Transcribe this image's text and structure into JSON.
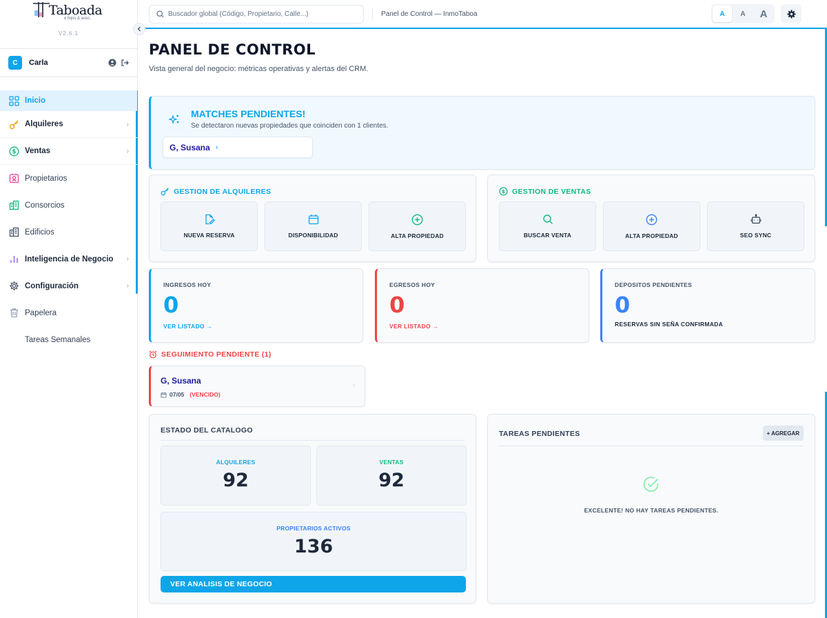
{
  "app": {
    "logo_text": "Taboada",
    "logo_sub": "e hijos & asoc.",
    "version": "V2.6.1"
  },
  "user": {
    "initial": "C",
    "name": "Carla"
  },
  "sidebar": {
    "items": [
      {
        "label": "Inicio",
        "icon": "grid-icon"
      },
      {
        "label": "Alquileres",
        "icon": "key-icon"
      },
      {
        "label": "Ventas",
        "icon": "dollar-circle-icon"
      },
      {
        "label": "Propietarios",
        "icon": "contact-icon"
      },
      {
        "label": "Consorcios",
        "icon": "building-icon"
      },
      {
        "label": "Edificios",
        "icon": "building-icon"
      },
      {
        "label": "Inteligencia de Negocio",
        "icon": "bar-chart-icon"
      },
      {
        "label": "Configuración",
        "icon": "gear-icon"
      },
      {
        "label": "Papelera",
        "icon": "trash-icon"
      },
      {
        "label": "Tareas Semanales"
      }
    ]
  },
  "topbar": {
    "search_placeholder": "Buscador global (Código, Propietario, Calle...)",
    "breadcrumb": "Panel de Control — InmoTaboa",
    "font_sizes": [
      "A",
      "A",
      "A"
    ]
  },
  "page": {
    "title": "PANEL DE CONTROL",
    "subtitle": "Vista general del negocio: métricas operativas y alertas del CRM."
  },
  "matches": {
    "title": "MATCHES PENDIENTES!",
    "description": "Se detectaron nuevas propiedades que coinciden con 1 clientes.",
    "client": "G, Susana",
    "arrow": "›"
  },
  "alquileres": {
    "title": "GESTION DE ALQUILERES",
    "buttons": [
      "NUEVA RESERVA",
      "DISPONIBILIDAD",
      "ALTA PROPIEDAD"
    ]
  },
  "ventas": {
    "title": "GESTION DE VENTAS",
    "buttons": [
      "BUSCAR VENTA",
      "ALTA PROPIEDAD",
      "SEO SYNC"
    ]
  },
  "stats": {
    "ingresos": {
      "label": "INGRESOS HOY",
      "value": "0",
      "link": "VER LISTADO →"
    },
    "egresos": {
      "label": "EGRESOS HOY",
      "value": "0",
      "link": "VER LISTADO →"
    },
    "depositos": {
      "label": "DEPOSITOS PENDIENTES",
      "value": "0",
      "note": "RESERVAS SIN SEÑA CONFIRMADA"
    }
  },
  "seguimiento": {
    "title": "SEGUIMIENTO PENDIENTE (1)",
    "client": "G, Susana",
    "date": "07/05",
    "status": "(VENCIDO)"
  },
  "catalog": {
    "title": "ESTADO DEL CATALOGO",
    "alquileres_label": "ALQUILERES",
    "alquileres_value": "92",
    "ventas_label": "VENTAS",
    "ventas_value": "92",
    "propietarios_label": "PROPIETARIOS ACTIVOS",
    "propietarios_value": "136",
    "button": "VER ANALISIS DE NEGOCIO"
  },
  "tasks": {
    "title": "TAREAS PENDIENTES",
    "add_label": "+ AGREGAR",
    "empty": "EXCELENTE! NO HAY TAREAS PENDIENTES."
  },
  "colors": {
    "accent": "#0ea5e9",
    "danger": "#ef4444",
    "success": "#10b981",
    "info": "#3b82f6",
    "rent": "#f59e0b"
  }
}
